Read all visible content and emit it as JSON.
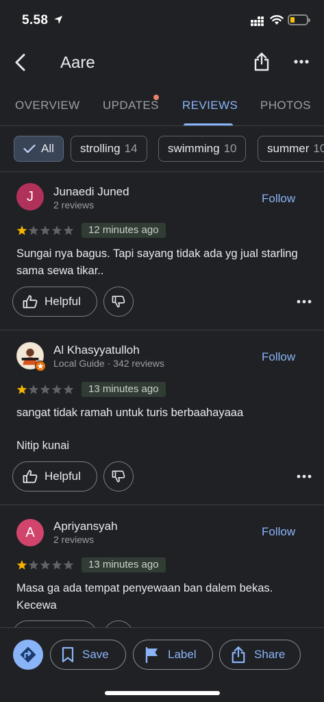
{
  "status_bar": {
    "time": "5.58",
    "battery_color": "#f4c20d"
  },
  "header": {
    "title": "Aare"
  },
  "tabs": [
    {
      "label": "OVERVIEW"
    },
    {
      "label": "UPDATES"
    },
    {
      "label": "REVIEWS",
      "active": true
    },
    {
      "label": "PHOTOS"
    }
  ],
  "filters": [
    {
      "label": "All",
      "selected": true
    },
    {
      "label": "strolling",
      "count": "14"
    },
    {
      "label": "swimming",
      "count": "10"
    },
    {
      "label": "summer",
      "count": "10"
    }
  ],
  "reviews": [
    {
      "initial": "J",
      "avatar_color": "#b0325a",
      "author": "Junaedi Juned",
      "meta": "2 reviews",
      "follow_label": "Follow",
      "rating": 1,
      "time": "12 minutes ago",
      "text": "Sungai nya bagus. Tapi sayang tidak ada yg jual starling sama sewa tikar..",
      "helpful_label": "Helpful"
    },
    {
      "initial": "",
      "avatar_color": "#f3e7d6",
      "author": "Al Khasyyatulloh",
      "meta": "Local Guide · 342 reviews",
      "follow_label": "Follow",
      "rating": 1,
      "time": "13 minutes ago",
      "text_line1": "sangat tidak ramah untuk turis berbaahayaaa",
      "text_line2": "Nitip kunai",
      "helpful_label": "Helpful"
    },
    {
      "initial": "A",
      "avatar_color": "#d1446b",
      "author": "Apriyansyah",
      "meta": "2 reviews",
      "follow_label": "Follow",
      "rating": 1,
      "time": "13 minutes ago",
      "text": "Masa ga ada tempat penyewaan ban dalem bekas. Kecewa"
    }
  ],
  "bottom_actions": {
    "directions_icon": "directions-icon",
    "save_label": "Save",
    "label_label": "Label",
    "share_label": "Share"
  },
  "colors": {
    "accent": "#8ab4f8",
    "star_filled": "#f4b400",
    "star_empty": "#5f6368"
  }
}
